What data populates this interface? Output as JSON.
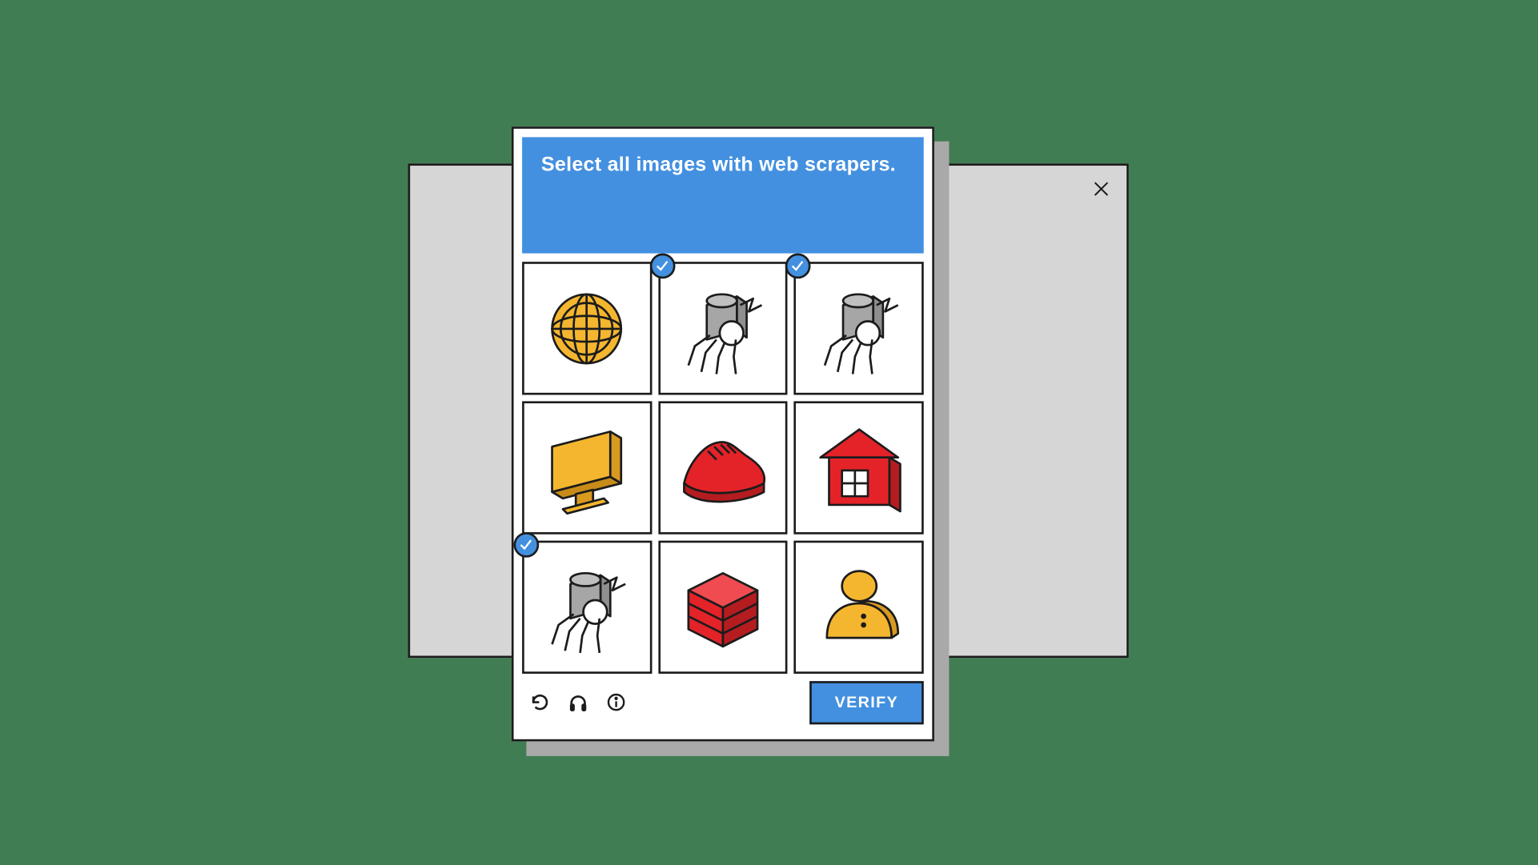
{
  "colors": {
    "background": "#417d53",
    "accent": "#4390e0",
    "panel_bg": "#ffffff",
    "border": "#1c1c1c",
    "back_window": "#d6d6d6",
    "shadow": "#a9a9a9",
    "yellow": "#f5b62f",
    "red": "#e42329",
    "gray": "#a6a6a6"
  },
  "captcha": {
    "instruction": "Select all images with web scrapers.",
    "verify_label": "VERIFY",
    "tiles": [
      {
        "icon": "globe",
        "selected": false
      },
      {
        "icon": "scraper",
        "selected": true
      },
      {
        "icon": "scraper",
        "selected": true
      },
      {
        "icon": "monitor",
        "selected": false
      },
      {
        "icon": "shoe",
        "selected": false
      },
      {
        "icon": "house",
        "selected": false
      },
      {
        "icon": "scraper",
        "selected": true
      },
      {
        "icon": "server",
        "selected": false
      },
      {
        "icon": "person",
        "selected": false
      }
    ],
    "footer_icons": [
      "refresh-icon",
      "headphones-icon",
      "info-icon"
    ]
  }
}
